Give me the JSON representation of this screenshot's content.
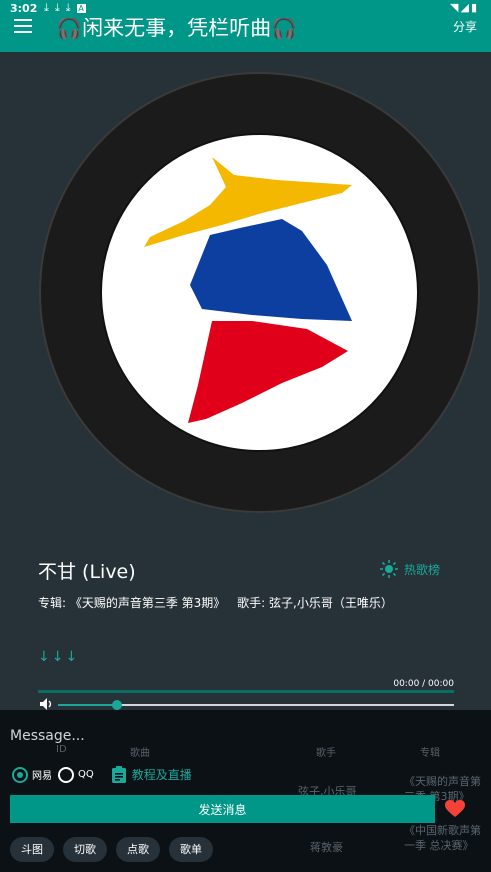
{
  "status_bar": {
    "time": "3:02",
    "notification_icons": [
      "download-icon",
      "download-icon",
      "download-icon",
      "font-icon"
    ],
    "right_icons": [
      "wifi-icon",
      "signal-icon",
      "battery-icon"
    ]
  },
  "app_bar": {
    "title": "🎧闲来无事，凭栏听曲🎧",
    "share_label": "分享"
  },
  "player": {
    "song_title": "不甘 (Live)",
    "hot_label": "热歌榜",
    "album_label": "专辑: 《天赐的声音第三季 第3期》",
    "artist_label": "歌手: 弦子,小乐哥（王唯乐）",
    "arrows": "↓↓↓",
    "time": "00:00 / 00:00",
    "progress": 0,
    "volume": 0.15
  },
  "ghost_table": {
    "headers": [
      "ID",
      "歌曲",
      "歌手",
      "专辑"
    ],
    "rows": [
      [
        "弦子,小乐哥",
        "《天赐的声音第三季 第3期》"
      ],
      [
        "蒋敦豪",
        "《中国新歌声第一季 总决赛》"
      ]
    ]
  },
  "chat": {
    "message_placeholder": "Message...",
    "source_options": [
      "网易",
      "QQ"
    ],
    "selected_source": "网易",
    "tutorial_label": "教程及直播",
    "send_label": "发送消息",
    "chips": [
      "斗图",
      "切歌",
      "点歌",
      "歌单"
    ]
  },
  "colors": {
    "accent": "#009688",
    "accent_light": "#1aa89a",
    "background": "#263238",
    "bottom_panel": "#0b1115",
    "heart": "#f44336",
    "hat": "#f5b800",
    "blue": "#0d3fa0",
    "red": "#e0001a"
  }
}
